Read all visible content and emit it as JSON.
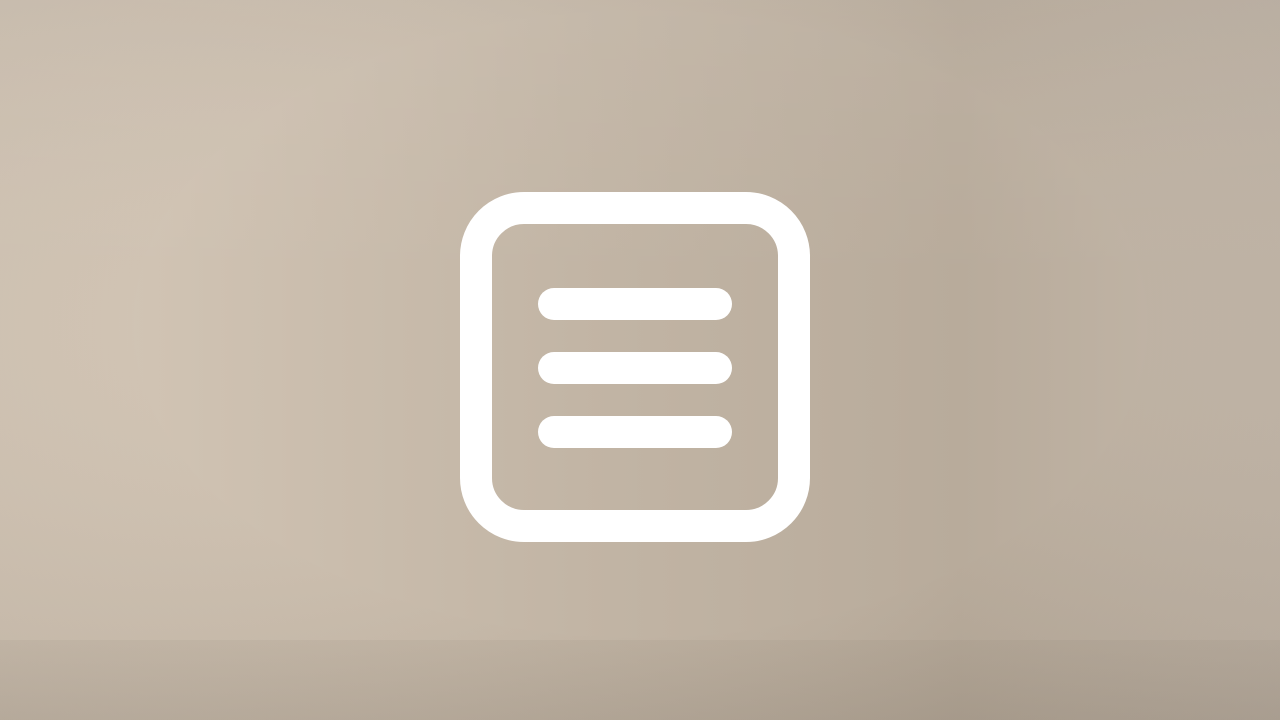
{
  "background": {
    "colors": [
      "#d5c8b8",
      "#c2b5a5",
      "#b8ab9b"
    ]
  },
  "center_icon": {
    "name": "menu-list-icon",
    "color": "#ffffff"
  }
}
